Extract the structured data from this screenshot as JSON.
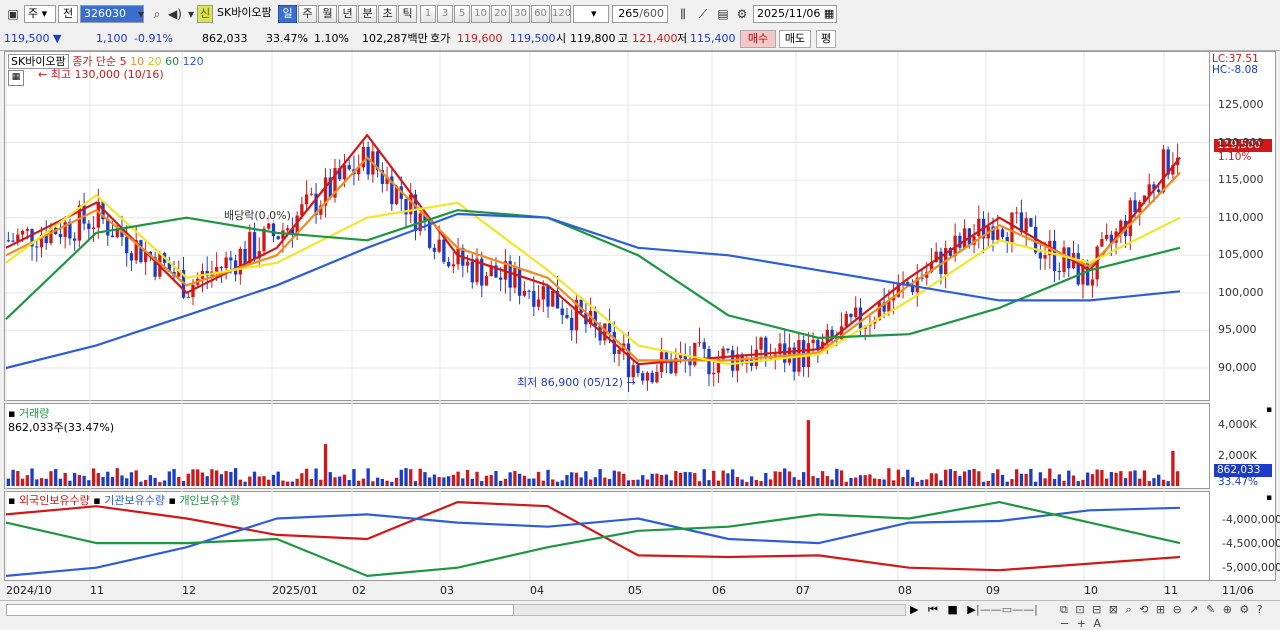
{
  "toolbar": {
    "period_label": "주",
    "prev_label": "전",
    "code": "326030",
    "stock_name": "SK바이오팜",
    "credit_badge": "신",
    "periods": [
      "일",
      "주",
      "월",
      "년",
      "분",
      "초",
      "틱"
    ],
    "active_period": "일",
    "intervals": [
      "1",
      "3",
      "5",
      "10",
      "20",
      "30",
      "60",
      "120"
    ],
    "count": "265",
    "count_total": "/600",
    "date": "2025/11/06"
  },
  "quote": {
    "price": "119,500",
    "change_arrow": "▼",
    "change": "1,100",
    "change_pct": "-0.91%",
    "volume": "862,033",
    "turnover": "33.47%",
    "vol_change": "1.10%",
    "amount": "102,287백만",
    "ask_label": "호가",
    "ask": "119,600",
    "bid": "119,500",
    "open_label": "시",
    "open": "119,800",
    "high_label": "고",
    "high": "121,400",
    "low_label": "저",
    "low": "115,400",
    "buy_label": "매수",
    "sell_label": "매도",
    "eval_label": "평"
  },
  "chart": {
    "name": "SK바이오팜",
    "legend_prefix": "종가 단순",
    "ma_periods": [
      {
        "label": "5",
        "color": "#d01818"
      },
      {
        "label": "10",
        "color": "#f08c1e"
      },
      {
        "label": "20",
        "color": "#f0e628"
      },
      {
        "label": "60",
        "color": "#1e9641"
      },
      {
        "label": "120",
        "color": "#2d5fd2"
      }
    ],
    "high_note": "최고 130,000 (10/16)",
    "low_note": "최저 86,900 (05/12)",
    "dividend_note": "배당락(0.0%)",
    "lc": "LC:37.51",
    "hc": "HC:-8.08",
    "price_box": "119,500",
    "price_box_pct": "1.10%",
    "yticks": [
      "125,000",
      "120,000",
      "115,000",
      "110,000",
      "105,000",
      "100,000",
      "95,000",
      "90,000"
    ]
  },
  "volume": {
    "title": "거래량",
    "value_line": "862,033주(33.47%)",
    "yticks": [
      "4,000K",
      "2,000K"
    ],
    "box": "862,033",
    "box_pct": "33.47%"
  },
  "flow": {
    "legend": [
      {
        "label": "외국인보유수량",
        "color": "#d01818"
      },
      {
        "label": "기관보유수량",
        "color": "#2d5fd2"
      },
      {
        "label": "개인보유수량",
        "color": "#1e9641"
      }
    ],
    "yticks": [
      "-4,000,000",
      "-4,500,000",
      "-5,000,000"
    ]
  },
  "xaxis": [
    "2024/10",
    "11",
    "12",
    "2025/01",
    "02",
    "03",
    "04",
    "05",
    "06",
    "07",
    "08",
    "09",
    "10",
    "11",
    "11/06"
  ],
  "chart_data": {
    "type": "candlestick",
    "title": "SK바이오팜",
    "ylim": [
      86000,
      131000
    ],
    "x": [
      "2024/10",
      "11",
      "12",
      "2025/01",
      "02",
      "03",
      "04",
      "05",
      "06",
      "07",
      "08",
      "09",
      "10",
      "11"
    ],
    "close_monthly_approx": [
      107000,
      110000,
      101000,
      108000,
      118000,
      104000,
      100000,
      90000,
      91500,
      92000,
      101000,
      110000,
      102000,
      119500
    ],
    "series": [
      {
        "name": "5",
        "values": [
          106000,
          112000,
          100000,
          106000,
          121000,
          105000,
          101000,
          90500,
          91500,
          92500,
          102000,
          110000,
          103000,
          118000
        ]
      },
      {
        "name": "10",
        "values": [
          105000,
          111000,
          101000,
          105000,
          118000,
          106000,
          102000,
          91000,
          91000,
          92000,
          101000,
          109000,
          103500,
          116000
        ]
      },
      {
        "name": "20",
        "values": [
          104000,
          113000,
          102000,
          104000,
          110000,
          112000,
          103000,
          93000,
          90500,
          91800,
          99000,
          107000,
          104000,
          110000
        ]
      },
      {
        "name": "60",
        "values": [
          96500,
          108000,
          110000,
          108000,
          107000,
          111000,
          110000,
          105000,
          97000,
          94000,
          94500,
          98000,
          103000,
          106000
        ]
      },
      {
        "name": "120",
        "values": [
          90000,
          93000,
          97000,
          101000,
          106000,
          110500,
          110000,
          106000,
          105000,
          103000,
          101000,
          99000,
          99000,
          100200
        ]
      }
    ]
  }
}
